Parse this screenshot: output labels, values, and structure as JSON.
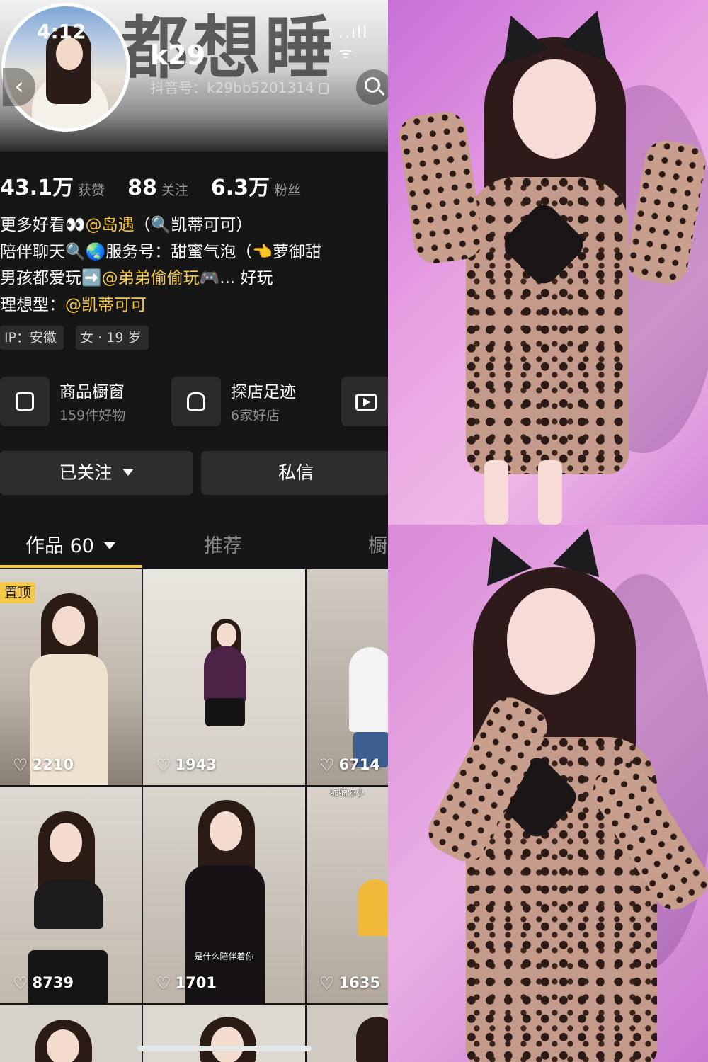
{
  "status_bar": {
    "time": "4:12",
    "icons": "..ıll ᯤ"
  },
  "header": {
    "banner_text": "都想睡",
    "back_icon": "chevron-left-icon",
    "search_icon": "search-icon"
  },
  "profile": {
    "nickname": "k29",
    "douyin_id": "抖音号：k29bb5201314",
    "stats": [
      {
        "value": "43.1万",
        "label": "获赞"
      },
      {
        "value": "88",
        "label": "关注"
      },
      {
        "value": "6.3万",
        "label": "粉丝"
      }
    ],
    "bio": {
      "line1_a": "更多好看👀",
      "line1_mention": "@岛遇",
      "line1_b": "（🔍凯蒂可可）",
      "line2": "陪伴聊天🔍🌏服务号：甜蜜气泡（👈萝御甜",
      "line3_a": "男孩都爱玩➡️",
      "line3_mention": "@弟弟偷偷玩",
      "line3_b": "🎮... 好玩",
      "line4_a": "理想型：",
      "line4_mention": "@凯蒂可可"
    },
    "tags": [
      "IP：安徽",
      "女 · 19 岁"
    ]
  },
  "features": [
    {
      "title": "商品橱窗",
      "sub": "159件好物",
      "icon": "shopping-bag-icon"
    },
    {
      "title": "探店足迹",
      "sub": "6家好店",
      "icon": "store-icon"
    }
  ],
  "live_icon": "tv-play-icon",
  "actions": {
    "follow": "已关注",
    "message": "私信"
  },
  "tabs": {
    "works": "作品 60",
    "recommend": "推荐",
    "shop": "橱"
  },
  "grid": {
    "pinned": "置顶",
    "likes": [
      "2210",
      "1943",
      "6714",
      "8739",
      "1701",
      "1635"
    ],
    "subtitle_tile5": "是什么陪伴着你",
    "subtitle_tile6": "呢喃你小"
  },
  "colors": {
    "accent": "#f5c84a",
    "background": "#161616",
    "card": "#2b2b2b"
  }
}
